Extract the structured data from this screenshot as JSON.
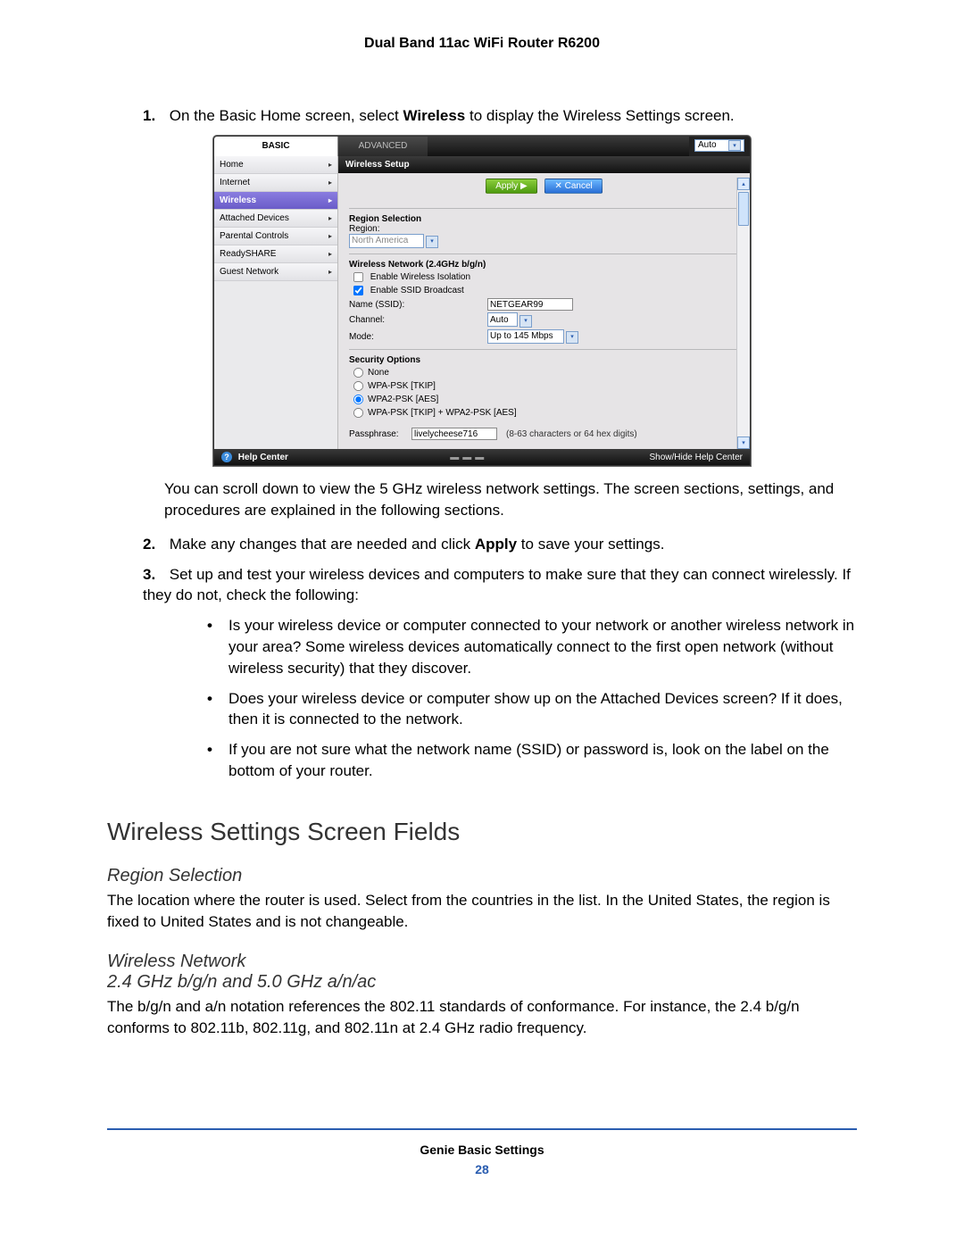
{
  "doc": {
    "title": "Dual Band 11ac WiFi Router R6200",
    "footer_title": "Genie Basic Settings",
    "page_number": "28"
  },
  "steps": {
    "s1_num": "1.",
    "s1_a": "On the Basic Home screen, select ",
    "s1_b": "Wireless",
    "s1_c": " to display the Wireless Settings screen.",
    "s1_follow": "You can scroll down to view the 5 GHz wireless network settings. The screen sections, settings, and procedures are explained in the following sections.",
    "s2_num": "2.",
    "s2_a": "Make any changes that are needed and click ",
    "s2_b": "Apply",
    "s2_c": " to save your settings.",
    "s3_num": "3.",
    "s3_text": "Set up and test your wireless devices and computers to make sure that they can connect wirelessly. If they do not, check the following:",
    "b1": "Is your wireless device or computer connected to your network or another wireless network in your area? Some wireless devices automatically connect to the first open network (without wireless security) that they discover.",
    "b2": "Does your wireless device or computer show up on the Attached Devices screen? If it does, then it is connected to the network.",
    "b3": "If you are not sure what the network name (SSID) or password is, look on the label on the bottom of your router."
  },
  "section": {
    "title": "Wireless Settings Screen Fields",
    "sub1": "Region Selection",
    "sub1_text": "The location where the router is used. Select from the countries in the list. In the United States, the region is fixed to United States and is not changeable.",
    "sub2a": "Wireless Network",
    "sub2b": "2.4 GHz b/g/n and 5.0 GHz a/n/ac",
    "sub2_text": "The b/g/n and a/n notation references the 802.11 standards of conformance. For instance, the 2.4 b/g/n conforms to 802.11b, 802.11g, and 802.11n at 2.4 GHz radio frequency."
  },
  "router": {
    "tabs": {
      "basic": "BASIC",
      "advanced": "ADVANCED",
      "auto": "Auto"
    },
    "sidebar": [
      "Home",
      "Internet",
      "Wireless",
      "Attached Devices",
      "Parental Controls",
      "ReadySHARE",
      "Guest Network"
    ],
    "sidebar_active_index": 2,
    "panel_title": "Wireless Setup",
    "buttons": {
      "apply": "Apply ▶",
      "cancel": "✕ Cancel"
    },
    "region": {
      "heading": "Region Selection",
      "label": "Region:",
      "value": "North America"
    },
    "net24": {
      "heading": "Wireless Network (2.4GHz b/g/n)",
      "isolation": "Enable Wireless Isolation",
      "isolation_checked": false,
      "broadcast": "Enable SSID Broadcast",
      "broadcast_checked": true,
      "name_label": "Name (SSID):",
      "name_value": "NETGEAR99",
      "channel_label": "Channel:",
      "channel_value": "Auto",
      "mode_label": "Mode:",
      "mode_value": "Up to 145 Mbps"
    },
    "security": {
      "heading": "Security Options",
      "options": [
        "None",
        "WPA-PSK [TKIP]",
        "WPA2-PSK [AES]",
        "WPA-PSK [TKIP] + WPA2-PSK [AES]"
      ],
      "selected_index": 2,
      "pass_label": "Passphrase:",
      "pass_value": "livelycheese716",
      "pass_hint": "(8-63 characters or 64 hex digits)"
    },
    "help": {
      "label": "Help Center",
      "toggle": "Show/Hide Help Center"
    },
    "arrow": "▸"
  }
}
